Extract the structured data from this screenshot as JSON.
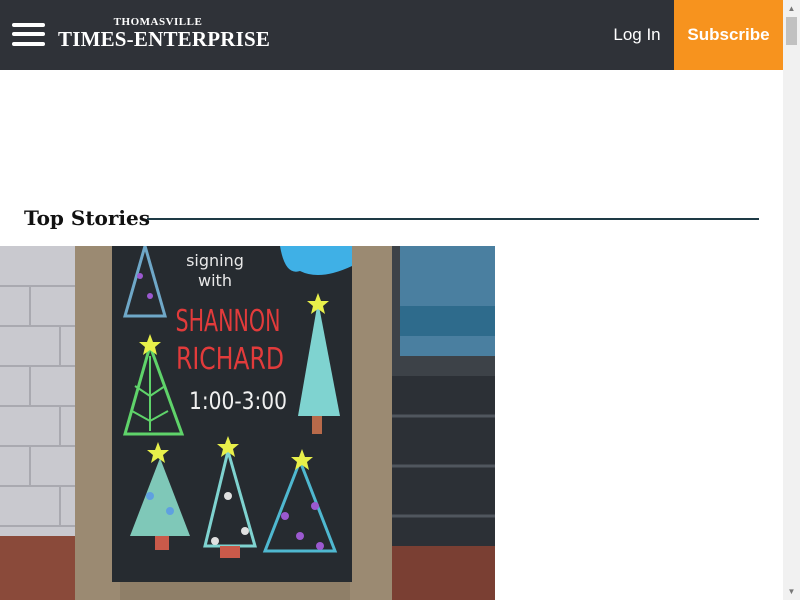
{
  "header": {
    "logo_top": "THOMASVILLE",
    "logo_main": "TIMES-ENTERPRISE",
    "login_label": "Log In",
    "subscribe_label": "Subscribe"
  },
  "section": {
    "title": "Top Stories"
  },
  "story_image": {
    "sign_lines": [
      "signing",
      "with",
      "SHANNON",
      "RICHARD",
      "1:00-3:00"
    ]
  },
  "colors": {
    "header_bg": "#2f3238",
    "subscribe_bg": "#f7931e",
    "rule": "#1e3a45",
    "sign_red": "#e23b3b"
  },
  "icons": {
    "menu": "hamburger-menu-icon",
    "scroll_up": "scroll-up-arrow-icon",
    "scroll_down": "scroll-down-arrow-icon"
  }
}
